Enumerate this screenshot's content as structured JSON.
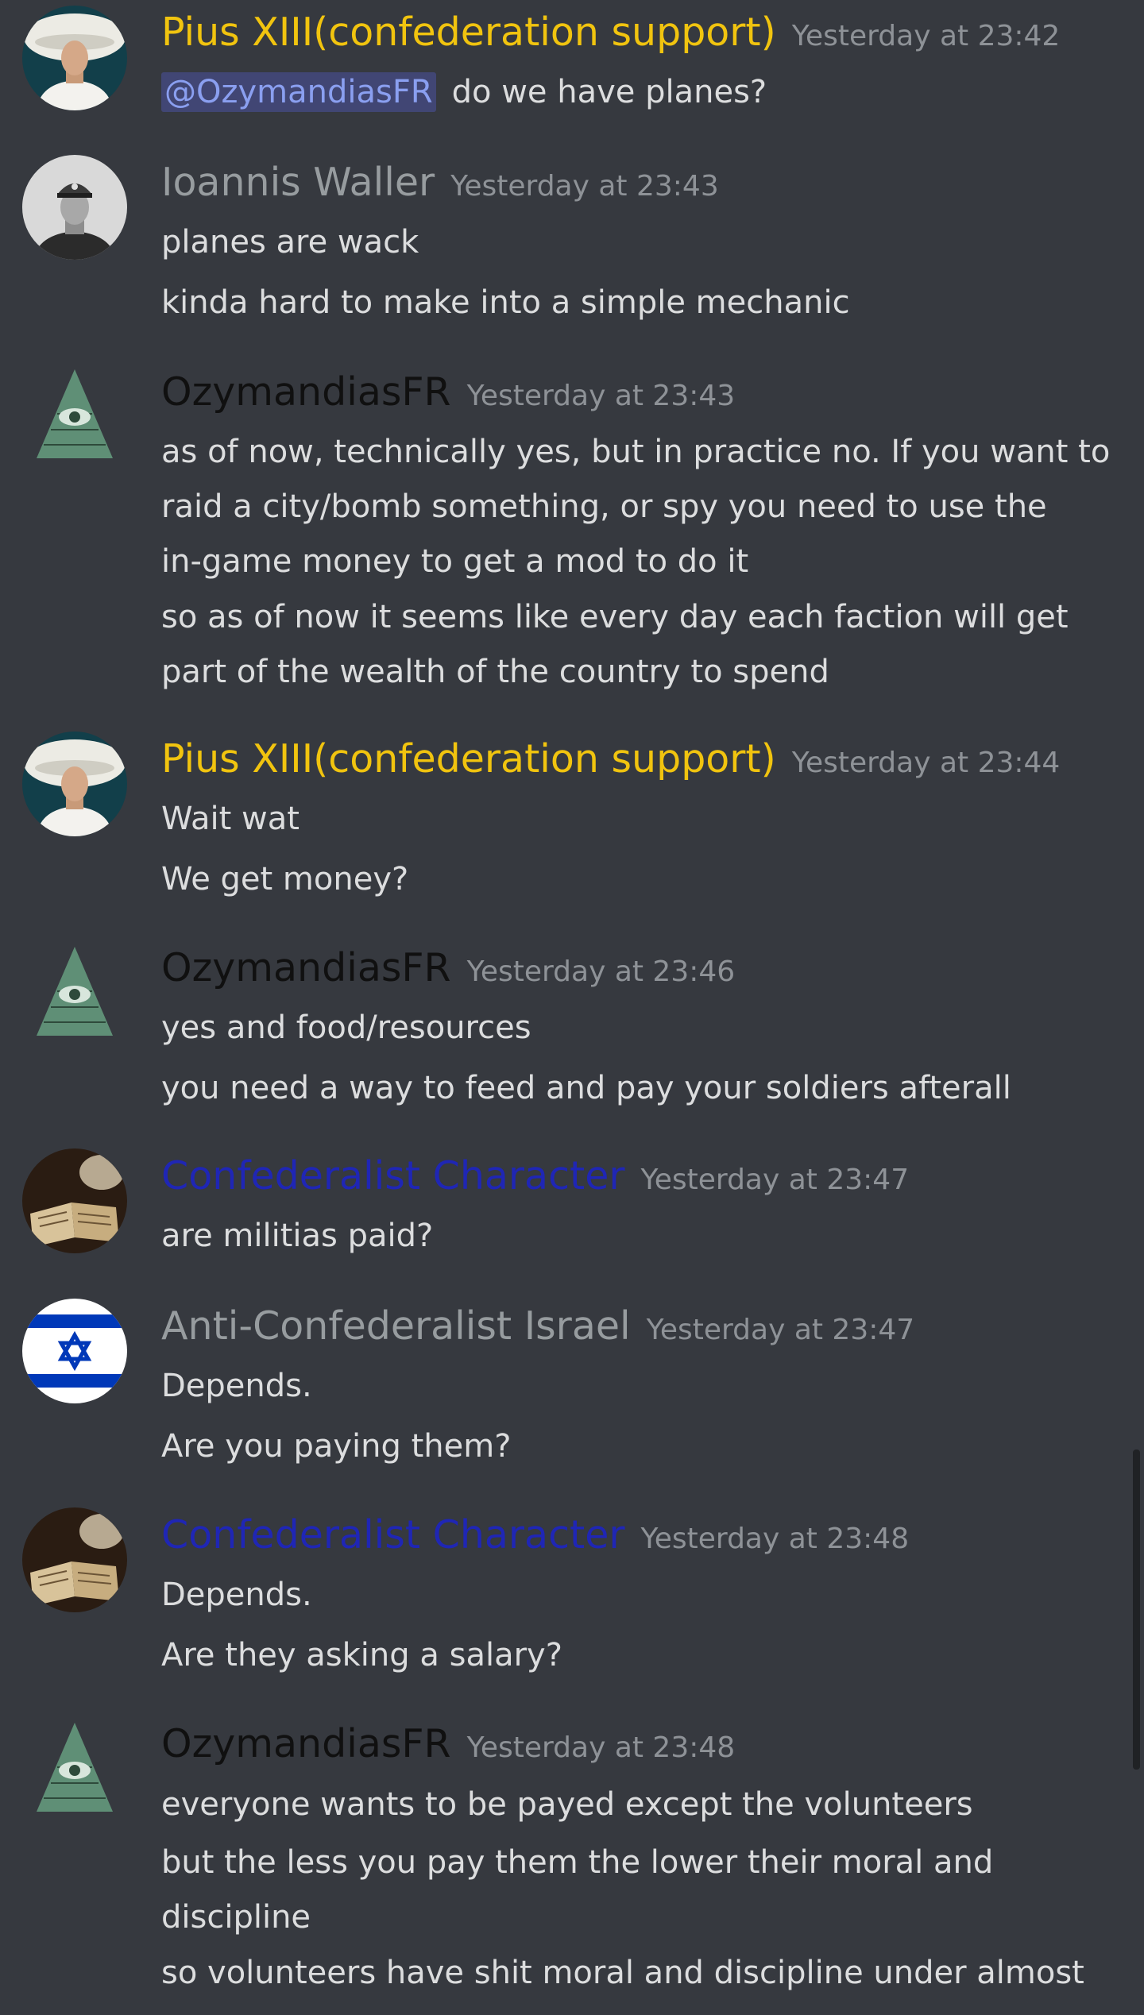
{
  "colors": {
    "background": "#36393f",
    "text": "#dcddde",
    "timestamp": "#8e9297",
    "role_yellow": "#f1c40f",
    "role_gray": "#979c9f",
    "role_black": "#101010",
    "role_blue": "#1f26b5",
    "mention_bg": "#414674",
    "mention_text": "#8a9ff0"
  },
  "messages": [
    {
      "username": "Pius XIII(confederation support)",
      "timestamp": "Yesterday at 23:42",
      "avatar": "pope-avatar",
      "lines": [
        {
          "mention": "@OzymandiasFR",
          "text": "do we have planes?"
        }
      ]
    },
    {
      "username": "Ioannis Waller",
      "timestamp": "Yesterday at 23:43",
      "avatar": "officer-avatar",
      "lines": [
        {
          "text": "planes are wack"
        },
        {
          "text": "kinda hard to make into a simple mechanic"
        }
      ]
    },
    {
      "username": "OzymandiasFR",
      "timestamp": "Yesterday at 23:43",
      "avatar": "illuminati-pyramid-avatar",
      "lines": [
        {
          "text": "as of now, technically yes, but in practice no. If you want to"
        },
        {
          "text": "raid a city/bomb something, or spy you need to use the"
        },
        {
          "text": "in-game money to get a mod to do it"
        },
        {
          "text": "so as of now it seems like every day each faction will get"
        },
        {
          "text": "part of the wealth of the country to spend"
        }
      ]
    },
    {
      "username": "Pius XIII(confederation support)",
      "timestamp": "Yesterday at 23:44",
      "avatar": "pope-avatar",
      "lines": [
        {
          "text": "Wait wat"
        },
        {
          "text": "We get money?"
        }
      ]
    },
    {
      "username": "OzymandiasFR",
      "timestamp": "Yesterday at 23:46",
      "avatar": "illuminati-pyramid-avatar",
      "lines": [
        {
          "text": "yes and food/resources"
        },
        {
          "text": "you need a way to feed and pay your soldiers afterall"
        }
      ]
    },
    {
      "username": "Confederalist Character",
      "timestamp": "Yesterday at 23:47",
      "avatar": "book-avatar",
      "lines": [
        {
          "text": "are militias paid?"
        }
      ]
    },
    {
      "username": "Anti-Confederalist Israel",
      "timestamp": "Yesterday at 23:47",
      "avatar": "israel-flag-avatar",
      "lines": [
        {
          "text": "Depends."
        },
        {
          "text": "Are you paying them?"
        }
      ]
    },
    {
      "username": "Confederalist Character",
      "timestamp": "Yesterday at 23:48",
      "avatar": "book-avatar",
      "lines": [
        {
          "text": "Depends."
        },
        {
          "text": "Are they asking a salary?"
        }
      ]
    },
    {
      "username": "OzymandiasFR",
      "timestamp": "Yesterday at 23:48",
      "avatar": "illuminati-pyramid-avatar",
      "lines": [
        {
          "text": "everyone wants to be payed except the volunteers"
        },
        {
          "text": "but the less you pay them the lower their moral and"
        },
        {
          "text": "discipline"
        },
        {
          "text": "so volunteers have shit moral and discipline under almost"
        }
      ]
    }
  ]
}
